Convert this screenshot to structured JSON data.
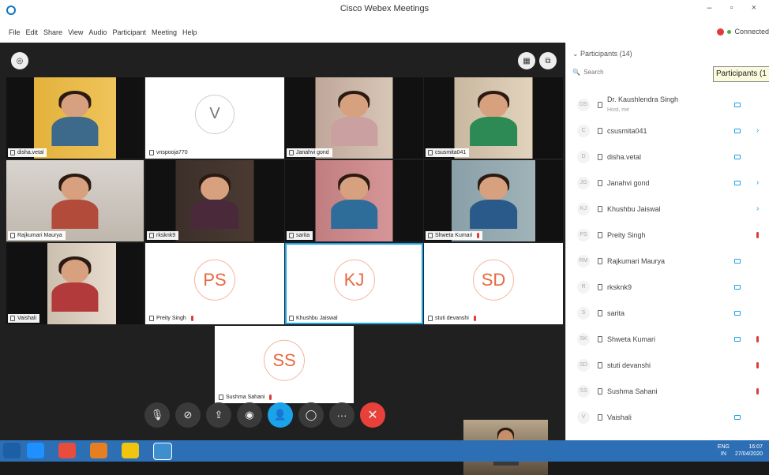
{
  "window": {
    "title": "Cisco Webex Meetings",
    "controls": "– ▫ ×"
  },
  "menu": [
    "File",
    "Edit",
    "Share",
    "View",
    "Audio",
    "Participant",
    "Meeting",
    "Help"
  ],
  "status": {
    "connection": "Connected"
  },
  "colors": {
    "accent": "#1aa3e8",
    "end_call": "#e8403a",
    "avatar_text": "#e8683f",
    "taskbar": "#2c6fb5"
  },
  "stage": {
    "tiles": [
      {
        "name": "disha.vetal",
        "type": "video",
        "selected": true
      },
      {
        "name": "vnspooja770",
        "type": "avatar",
        "initials": "V"
      },
      {
        "name": "Janahvi gond",
        "type": "video"
      },
      {
        "name": "csusmita041",
        "type": "video"
      },
      {
        "name": "Rajkumari Maurya",
        "type": "video"
      },
      {
        "name": "rksknk9",
        "type": "video"
      },
      {
        "name": "sarita",
        "type": "video"
      },
      {
        "name": "Shweta Kumari",
        "type": "video"
      },
      {
        "name": "Vaishali",
        "type": "video"
      },
      {
        "name": "Preity Singh",
        "type": "avatar",
        "initials": "PS"
      },
      {
        "name": "Khushbu Jaiswal",
        "type": "avatar",
        "initials": "KJ",
        "selected": true
      },
      {
        "name": "stuti devanshi",
        "type": "avatar",
        "initials": "SD"
      },
      {
        "name": "Sushma Sahani",
        "type": "avatar",
        "initials": "SS"
      }
    ]
  },
  "controls": [
    {
      "name": "mute-button",
      "glyph": "🎙"
    },
    {
      "name": "stop-video-button",
      "glyph": "⊘"
    },
    {
      "name": "share-button",
      "glyph": "⇪"
    },
    {
      "name": "record-button",
      "glyph": "◉"
    },
    {
      "name": "participants-button",
      "glyph": "👤"
    },
    {
      "name": "chat-button",
      "glyph": "◯"
    },
    {
      "name": "more-button",
      "glyph": "···"
    },
    {
      "name": "end-call-button",
      "glyph": "✕"
    }
  ],
  "panel": {
    "header": "Participants (14)",
    "search_placeholder": "Search",
    "tooltip": "Participants (1",
    "participants": [
      {
        "avatar": "DS",
        "name": "Dr. Kaushlendra Singh",
        "sub": "Host, me",
        "camera": true
      },
      {
        "avatar": "C",
        "name": "csusmita041",
        "camera": true,
        "chevron": true
      },
      {
        "avatar": "D",
        "name": "disha.vetal",
        "camera": true
      },
      {
        "avatar": "JG",
        "name": "Janahvi gond",
        "camera": true,
        "chevron": true
      },
      {
        "avatar": "KJ",
        "name": "Khushbu Jaiswal",
        "chevron": true
      },
      {
        "avatar": "PS",
        "name": "Preity Singh",
        "mic_muted": true
      },
      {
        "avatar": "RM",
        "name": "Rajkumari Maurya",
        "camera": true
      },
      {
        "avatar": "R",
        "name": "rksknk9",
        "camera": true
      },
      {
        "avatar": "S",
        "name": "sarita",
        "camera": true
      },
      {
        "avatar": "SK",
        "name": "Shweta Kumari",
        "camera": true,
        "mic_muted": true
      },
      {
        "avatar": "SD",
        "name": "stuti devanshi",
        "mic_muted": true
      },
      {
        "avatar": "SS",
        "name": "Sushma Sahani",
        "mic_muted": true
      },
      {
        "avatar": "V",
        "name": "Vaishali",
        "camera": true
      }
    ]
  },
  "taskbar": {
    "lang": "ENG",
    "region": "IN",
    "time": "16:07",
    "date": "27/04/2020"
  }
}
